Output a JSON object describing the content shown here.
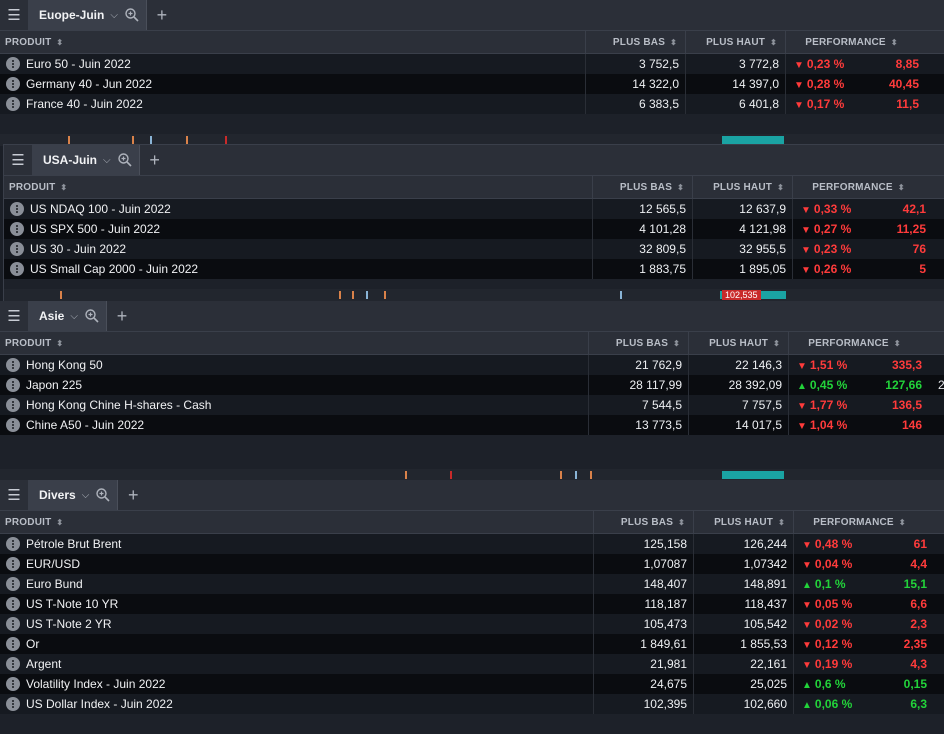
{
  "headers": {
    "product": "PRODUIT",
    "low": "PLUS BAS",
    "high": "PLUS HAUT",
    "perf": "PERFORMANCE"
  },
  "icons": {
    "menu": "hamburger-menu-icon",
    "chevron": "chevron-down-icon",
    "zoom": "zoom-in-icon",
    "add": "plus-icon",
    "more": "more-vertical-icon",
    "sort": "sort-icon"
  },
  "colors": {
    "down": "#ff3b3b",
    "up": "#22d33a",
    "accent": "#1aa3a3"
  },
  "panels": {
    "europe": {
      "tab": "Euope-Juin",
      "rows": [
        {
          "name": "Euro 50 - Juin 2022",
          "low": "3 752,5",
          "high": "3 772,8",
          "pct": "0,23 %",
          "chg": "8,85",
          "dir": "down"
        },
        {
          "name": "Germany 40 - Jun 2022",
          "low": "14 322,0",
          "high": "14 397,0",
          "pct": "0,28 %",
          "chg": "40,45",
          "dir": "down"
        },
        {
          "name": "France 40 - Juin 2022",
          "low": "6 383,5",
          "high": "6 401,8",
          "pct": "0,17 %",
          "chg": "11,5",
          "dir": "down"
        }
      ]
    },
    "usa": {
      "tab": "USA-Juin",
      "strip_label": "102,535",
      "rows": [
        {
          "name": "US NDAQ 100 - Juin 2022",
          "low": "12 565,5",
          "high": "12 637,9",
          "pct": "0,33 %",
          "chg": "42,1",
          "dir": "down"
        },
        {
          "name": "US SPX 500 - Juin 2022",
          "low": "4 101,28",
          "high": "4 121,98",
          "pct": "0,27 %",
          "chg": "11,25",
          "dir": "down"
        },
        {
          "name": "US 30 - Juin 2022",
          "low": "32 809,5",
          "high": "32 955,5",
          "pct": "0,23 %",
          "chg": "76",
          "dir": "down"
        },
        {
          "name": "US Small Cap 2000 - Juin 2022",
          "low": "1 883,75",
          "high": "1 895,05",
          "pct": "0,26 %",
          "chg": "5",
          "dir": "down"
        }
      ]
    },
    "asie": {
      "tab": "Asie",
      "extra": "2",
      "rows": [
        {
          "name": "Hong Kong 50",
          "low": "21 762,9",
          "high": "22 146,3",
          "pct": "1,51 %",
          "chg": "335,3",
          "dir": "down"
        },
        {
          "name": "Japon 225",
          "low": "28 117,99",
          "high": "28 392,09",
          "pct": "0,45 %",
          "chg": "127,66",
          "dir": "up"
        },
        {
          "name": "Hong Kong Chine H-shares - Cash",
          "low": "7 544,5",
          "high": "7 757,5",
          "pct": "1,77 %",
          "chg": "136,5",
          "dir": "down"
        },
        {
          "name": "Chine A50 - Juin 2022",
          "low": "13 773,5",
          "high": "14 017,5",
          "pct": "1,04 %",
          "chg": "146",
          "dir": "down"
        }
      ]
    },
    "divers": {
      "tab": "Divers",
      "rows": [
        {
          "name": "Pétrole Brut Brent",
          "low": "125,158",
          "high": "126,244",
          "pct": "0,48 %",
          "chg": "61",
          "dir": "down"
        },
        {
          "name": "EUR/USD",
          "low": "1,07087",
          "high": "1,07342",
          "pct": "0,04 %",
          "chg": "4,4",
          "dir": "down"
        },
        {
          "name": "Euro Bund",
          "low": "148,407",
          "high": "148,891",
          "pct": "0,1 %",
          "chg": "15,1",
          "dir": "up"
        },
        {
          "name": "US T-Note 10 YR",
          "low": "118,187",
          "high": "118,437",
          "pct": "0,05 %",
          "chg": "6,6",
          "dir": "down"
        },
        {
          "name": "US T-Note 2 YR",
          "low": "105,473",
          "high": "105,542",
          "pct": "0,02 %",
          "chg": "2,3",
          "dir": "down"
        },
        {
          "name": "Or",
          "low": "1 849,61",
          "high": "1 855,53",
          "pct": "0,12 %",
          "chg": "2,35",
          "dir": "down"
        },
        {
          "name": "Argent",
          "low": "21,981",
          "high": "22,161",
          "pct": "0,19 %",
          "chg": "4,3",
          "dir": "down"
        },
        {
          "name": "Volatility Index - Juin 2022",
          "low": "24,675",
          "high": "25,025",
          "pct": "0,6 %",
          "chg": "0,15",
          "dir": "up"
        },
        {
          "name": "US Dollar Index - Juin 2022",
          "low": "102,395",
          "high": "102,660",
          "pct": "0,06 %",
          "chg": "6,3",
          "dir": "up"
        }
      ]
    }
  }
}
